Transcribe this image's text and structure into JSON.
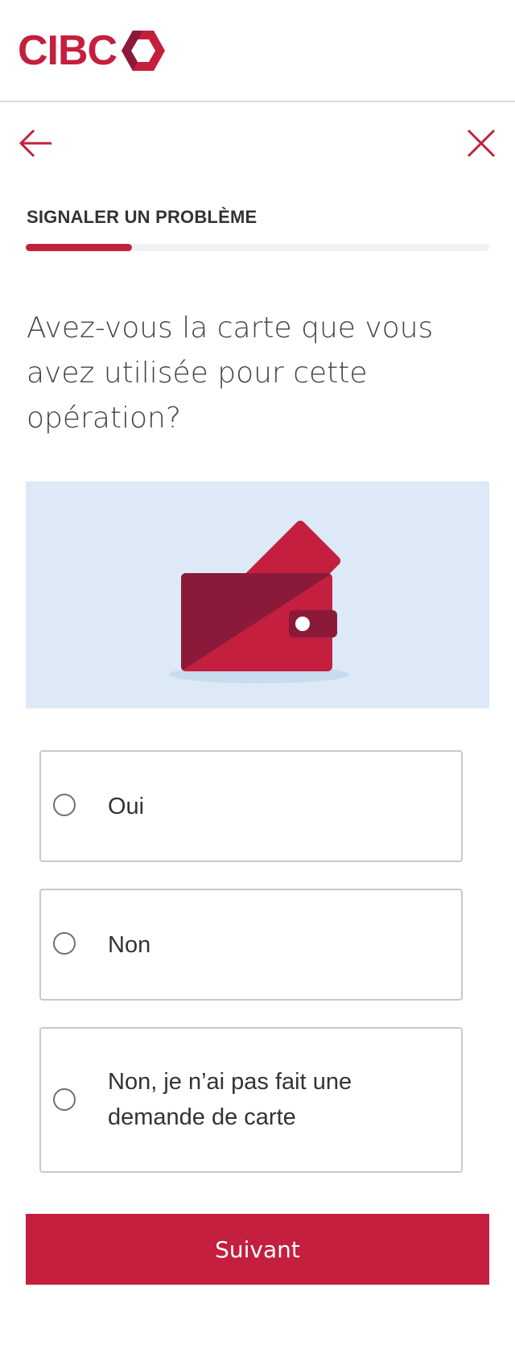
{
  "brand": {
    "logo_text": "CIBC",
    "color": "#c41f3e",
    "dark_color": "#8b1a3a"
  },
  "nav": {
    "back_icon": "arrow-left-icon",
    "close_icon": "close-icon"
  },
  "step": {
    "title": "SIGNALER UN PROBLÈME",
    "progress_percent": 23
  },
  "question": "Avez-vous la carte que vous avez utilisée pour cette opération?",
  "illustration": {
    "icon": "wallet-with-card-icon",
    "background": "#dde9f7"
  },
  "options": [
    {
      "label": "Oui",
      "selected": false
    },
    {
      "label": "Non",
      "selected": false
    },
    {
      "label": "Non, je n’ai pas fait une demande de carte",
      "selected": false
    }
  ],
  "submit": {
    "label": "Suivant"
  }
}
